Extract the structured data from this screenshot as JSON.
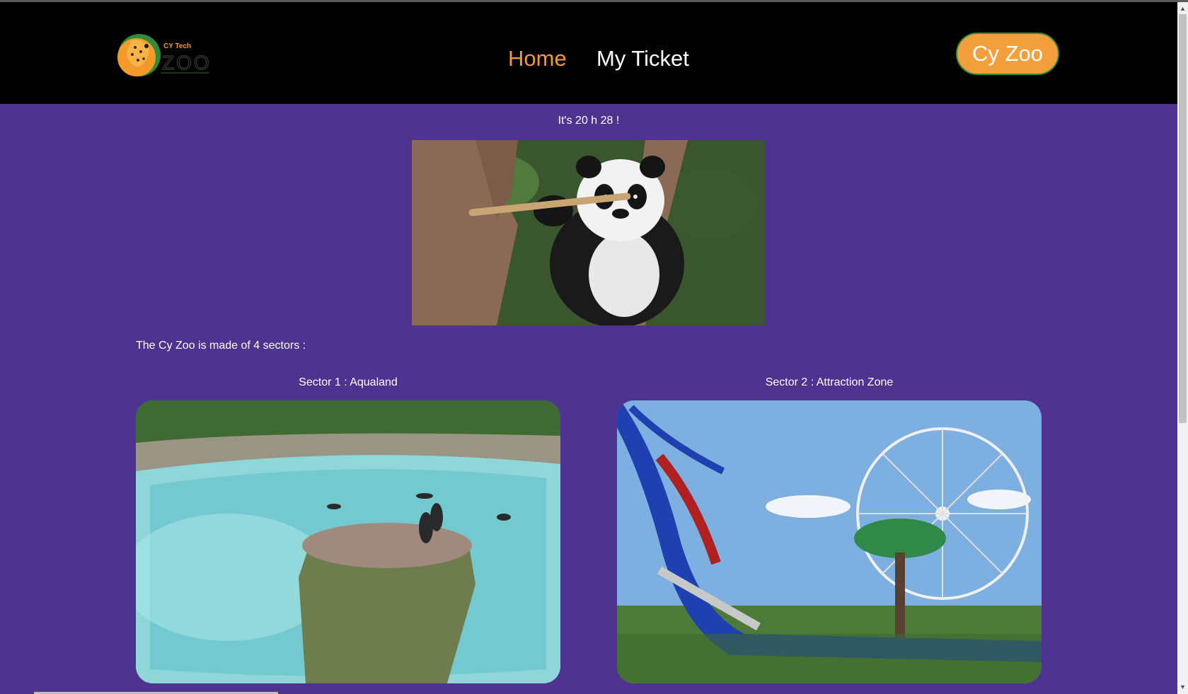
{
  "header": {
    "logo": {
      "top_text": "CY Tech",
      "word": "ZOO"
    },
    "nav": {
      "home": "Home",
      "ticket": "My Ticket"
    },
    "brand_button": "Cy Zoo"
  },
  "main": {
    "clock": "It's 20 h 28 !",
    "intro": "The Cy Zoo is made of 4 sectors :",
    "sectors": [
      {
        "title": "Sector 1 : Aqualand"
      },
      {
        "title": "Sector 2 : Attraction Zone"
      }
    ]
  },
  "colors": {
    "background": "#4e3490",
    "header": "#000000",
    "accent": "#f3973a",
    "button_border": "#2f8a3a"
  }
}
